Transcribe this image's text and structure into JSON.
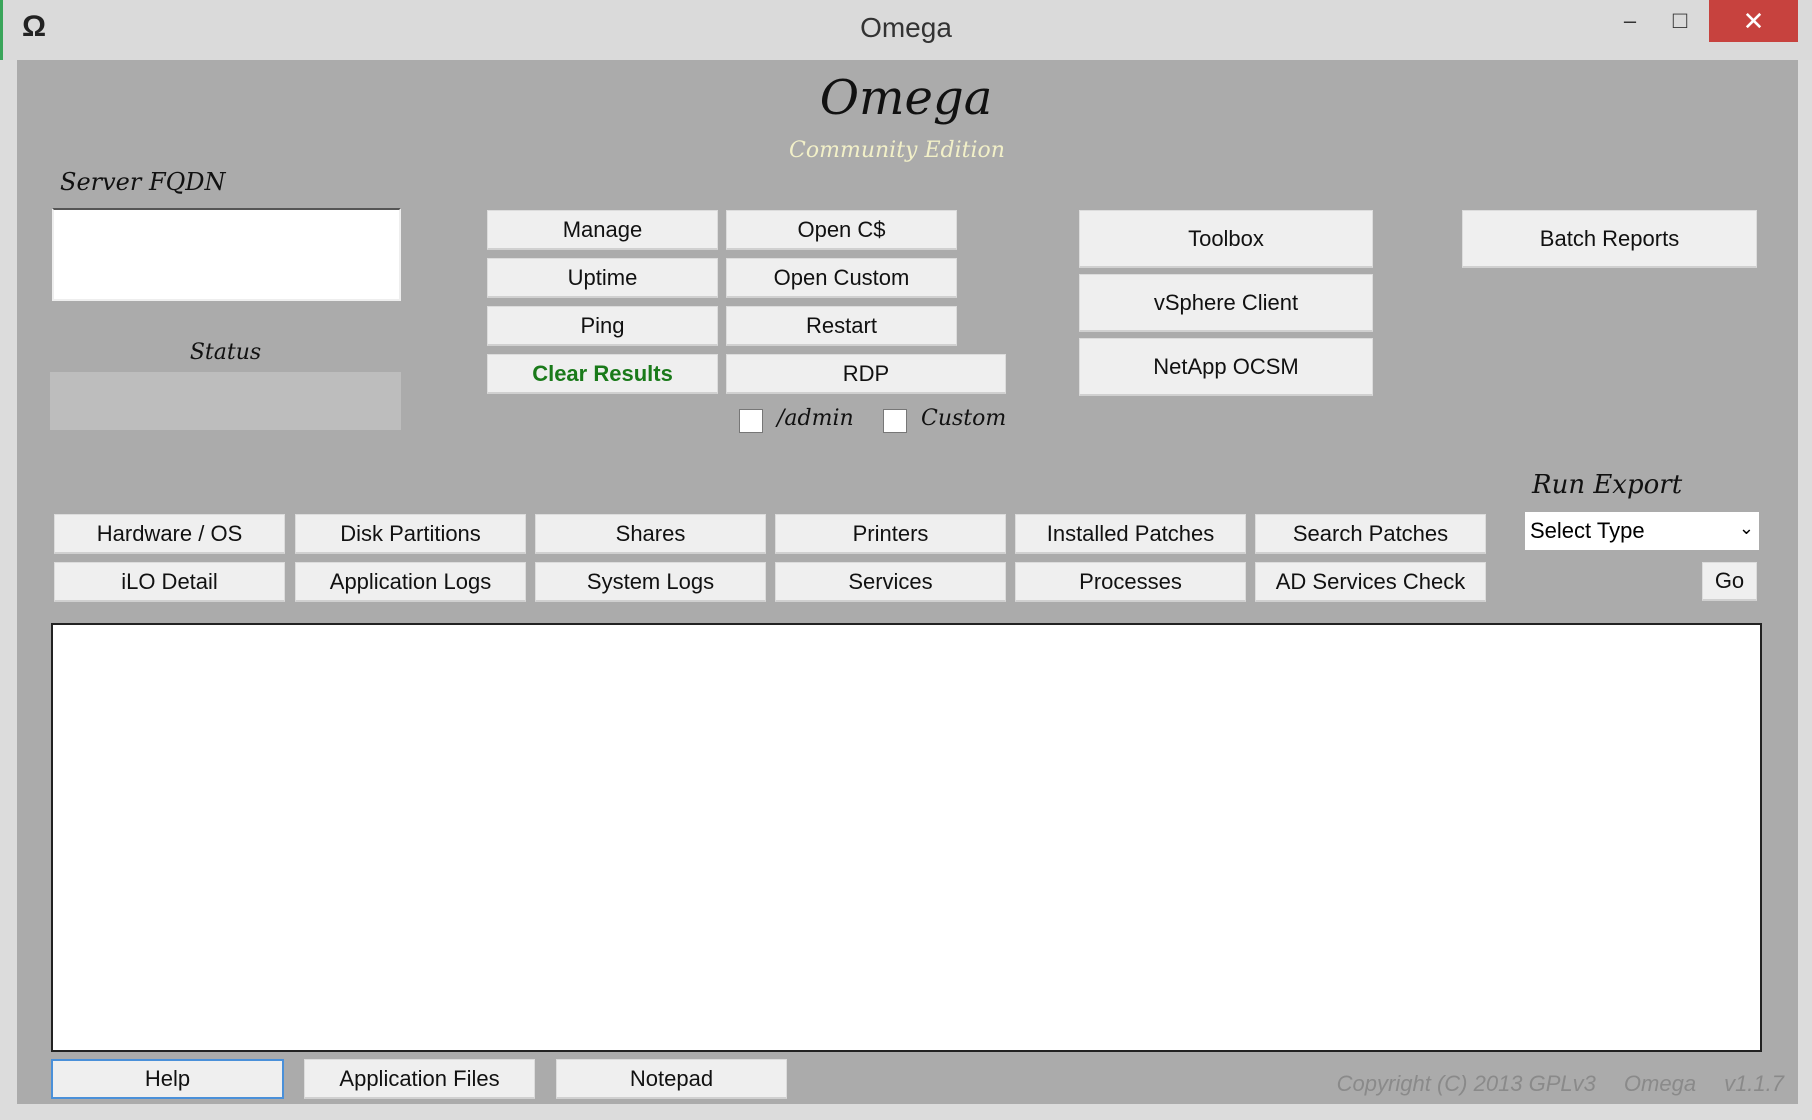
{
  "window": {
    "title": "Omega",
    "app_icon": "Ω",
    "minimize": "–",
    "maximize": "□",
    "close": "✕"
  },
  "header": {
    "logo": "Omega",
    "subtitle": "Community Edition"
  },
  "server": {
    "label": "Server FQDN",
    "value": "",
    "status_label": "Status"
  },
  "actions": {
    "manage": "Manage",
    "open_c": "Open C$",
    "uptime": "Uptime",
    "open_custom": "Open Custom",
    "ping": "Ping",
    "restart": "Restart",
    "clear": "Clear Results",
    "rdp": "RDP",
    "admin_label": "/admin",
    "custom_label": "Custom"
  },
  "tools": {
    "toolbox": "Toolbox",
    "vsphere": "vSphere Client",
    "netapp": "NetApp OCSM",
    "batch": "Batch Reports"
  },
  "export": {
    "label": "Run Export",
    "select": "Select Type",
    "go": "Go"
  },
  "reports": [
    [
      "Hardware / OS",
      "Disk Partitions",
      "Shares",
      "Printers",
      "Installed Patches",
      "Search Patches"
    ],
    [
      "iLO Detail",
      "Application Logs",
      "System Logs",
      "Services",
      "Processes",
      "AD Services Check"
    ]
  ],
  "output": "",
  "footer": {
    "help": "Help",
    "app_files": "Application Files",
    "notepad": "Notepad",
    "copyright": "Copyright (C) 2013 GPLv3",
    "product": "Omega",
    "version": "v1.1.7"
  },
  "colors": {
    "client_bg": "#ababab",
    "clear_green": "#1a7a1a",
    "close_red": "#c7423e"
  }
}
